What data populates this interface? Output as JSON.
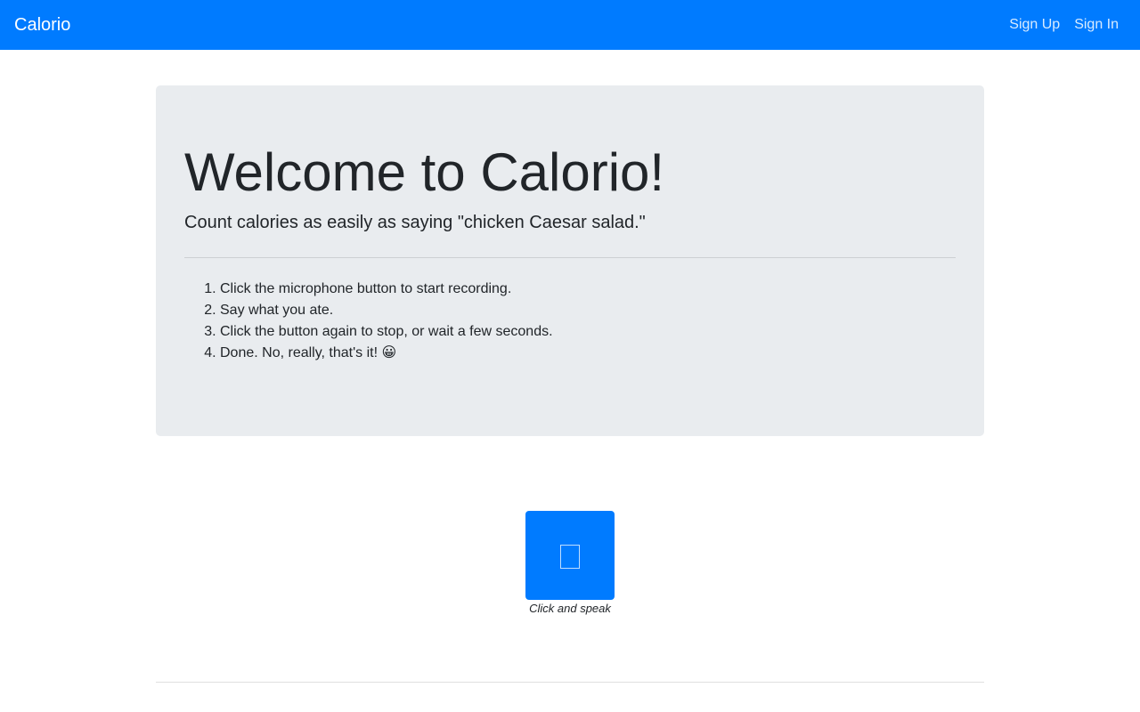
{
  "navbar": {
    "brand": "Calorio",
    "links": [
      {
        "label": "Sign Up"
      },
      {
        "label": "Sign In"
      }
    ],
    "color": "#007bff"
  },
  "jumbotron": {
    "title": "Welcome to Calorio!",
    "lead": "Count calories as easily as saying \"chicken Caesar salad.\"",
    "steps": [
      "Click the microphone button to start recording.",
      "Say what you ate.",
      "Click the button again to stop, or wait a few seconds.",
      "Done. No, really, that's it! 😀"
    ],
    "background": "#e9ecef"
  },
  "recorder": {
    "icon": "microphone-icon",
    "caption": "Click and speak",
    "button_color": "#007bff"
  }
}
